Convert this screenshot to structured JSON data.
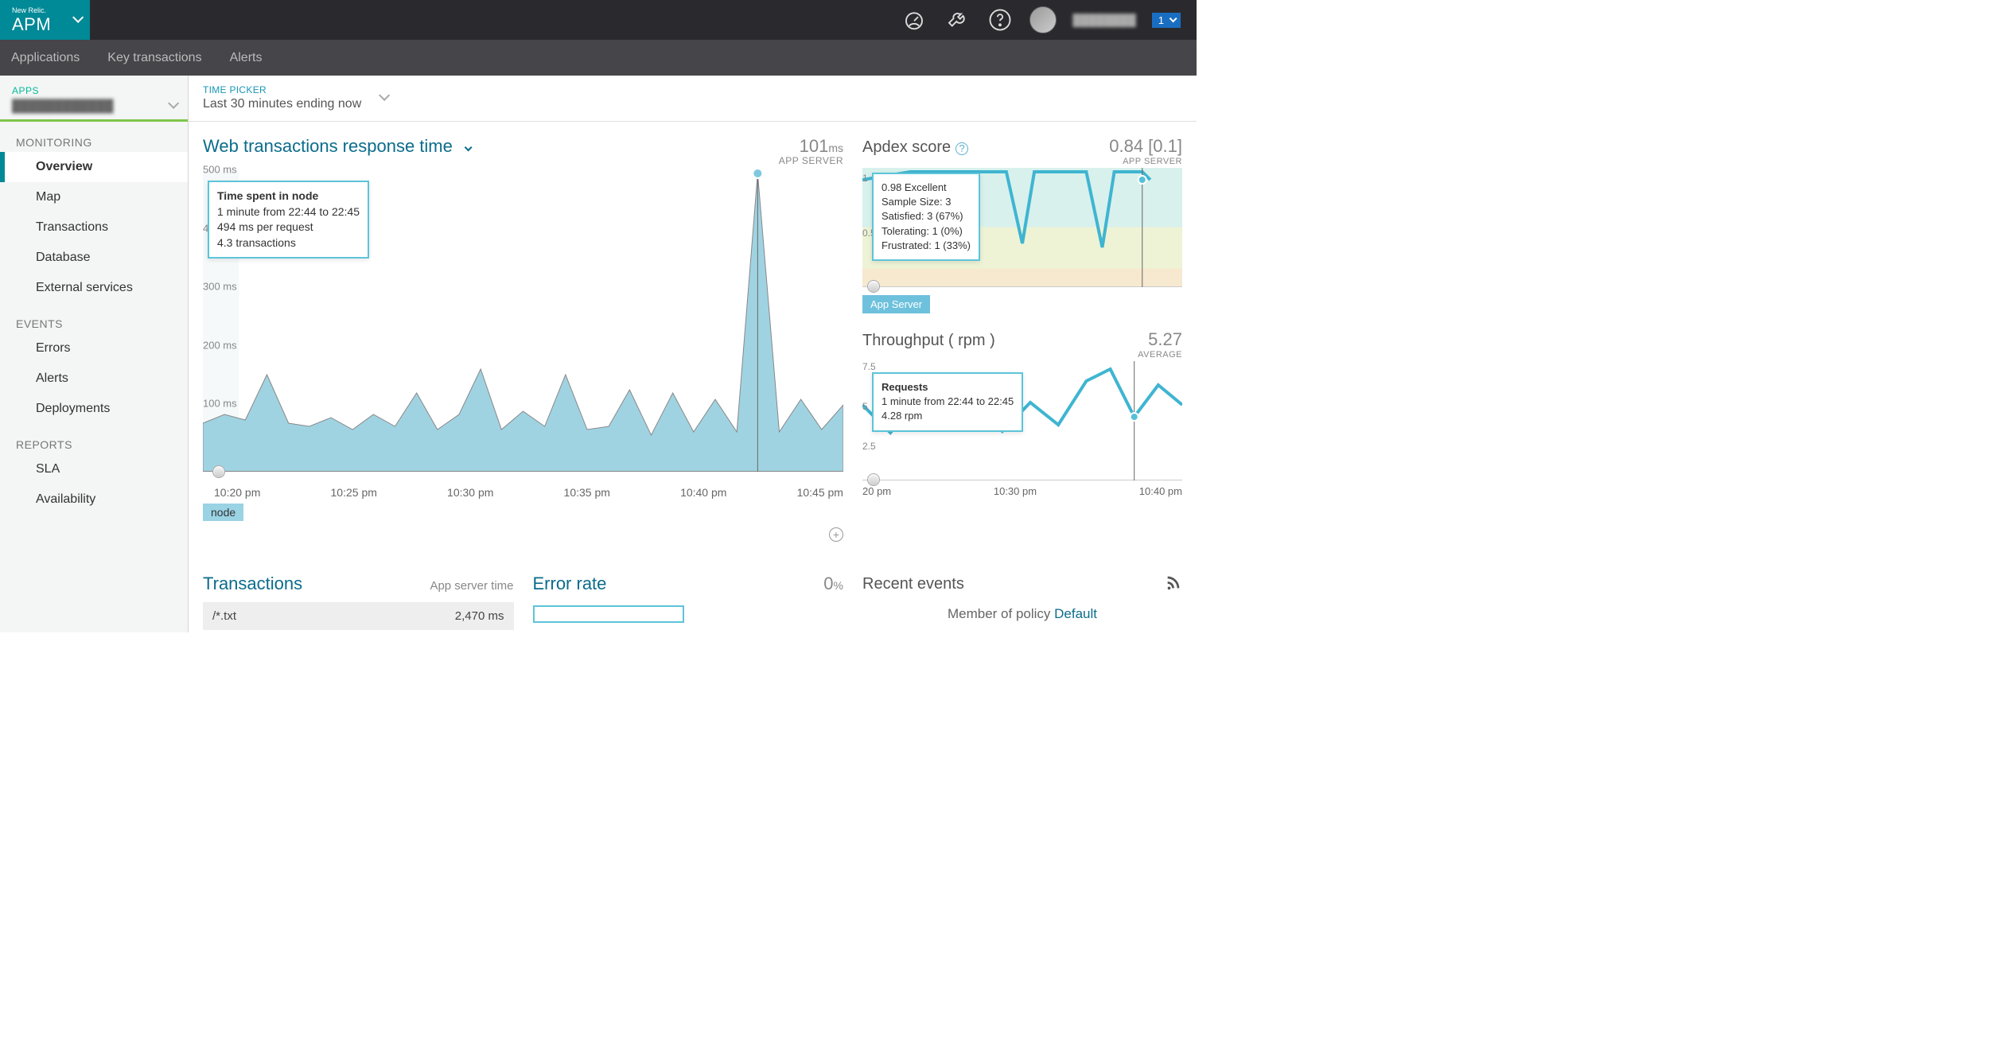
{
  "brand": {
    "vendor": "New Relic.",
    "product": "APM"
  },
  "topnav": {
    "apps": "Applications",
    "ktx": "Key transactions",
    "alerts": "Alerts"
  },
  "topright": {
    "notif_count": "1"
  },
  "apps_picker": {
    "label": "APPS"
  },
  "timepicker": {
    "label": "TIME PICKER",
    "value": "Last 30 minutes ending now"
  },
  "sidebar": {
    "sections": [
      {
        "label": "MONITORING",
        "items": [
          "Overview",
          "Map",
          "Transactions",
          "Database",
          "External services"
        ]
      },
      {
        "label": "EVENTS",
        "items": [
          "Errors",
          "Alerts",
          "Deployments"
        ]
      },
      {
        "label": "REPORTS",
        "items": [
          "SLA",
          "Availability"
        ]
      }
    ]
  },
  "web_chart": {
    "title": "Web transactions response time",
    "metric": "101",
    "metric_unit": "ms",
    "metric_sub": "APP SERVER",
    "tooltip": {
      "title": "Time spent in node",
      "l1": "1 minute from 22:44 to 22:45",
      "l2": "494 ms per request",
      "l3": "4.3 transactions"
    },
    "legend": "node",
    "y_ticks": [
      "500 ms",
      "400 ms",
      "300 ms",
      "200 ms",
      "100 ms",
      ""
    ],
    "x_ticks": [
      "10:20 pm",
      "10:25 pm",
      "10:30 pm",
      "10:35 pm",
      "10:40 pm",
      "10:45 pm"
    ]
  },
  "apdex": {
    "title": "Apdex score",
    "metric": "0.84 [0.1]",
    "sub": "APP SERVER",
    "tooltip": {
      "l1": "0.98 Excellent",
      "l2": "Sample Size: 3",
      "l3": "Satisfied: 3 (67%)",
      "l4": "Tolerating: 1 (0%)",
      "l5": "Frustrated: 1 (33%)"
    },
    "pill": "App Server",
    "y_ticks": [
      "1",
      "0.5"
    ]
  },
  "throughput": {
    "title": "Throughput ( rpm )",
    "metric": "5.27",
    "sub": "AVERAGE",
    "tooltip": {
      "l1": "Requests",
      "l2": "1 minute from 22:44 to 22:45",
      "l3": "4.28 rpm"
    },
    "y_ticks": [
      "7.5",
      "5",
      "2.5"
    ],
    "x_ticks": [
      "20 pm",
      "10:30 pm",
      "10:40 pm"
    ]
  },
  "transactions_panel": {
    "title": "Transactions",
    "col_label": "App server time",
    "row": {
      "name": "/*.txt",
      "value": "2,470 ms"
    }
  },
  "error_panel": {
    "title": "Error rate",
    "metric": "0",
    "unit": "%"
  },
  "events_panel": {
    "title": "Recent events",
    "policy_prefix": "Member of policy ",
    "policy_link": "Default"
  },
  "chart_data": [
    {
      "type": "area",
      "title": "Web transactions response time",
      "series": [
        {
          "name": "node",
          "x": [
            "22:17",
            "22:18",
            "22:19",
            "22:20",
            "22:21",
            "22:22",
            "22:23",
            "22:24",
            "22:25",
            "22:26",
            "22:27",
            "22:28",
            "22:29",
            "22:30",
            "22:31",
            "22:32",
            "22:33",
            "22:34",
            "22:35",
            "22:36",
            "22:37",
            "22:38",
            "22:39",
            "22:40",
            "22:41",
            "22:42",
            "22:43",
            "22:44",
            "22:45",
            "22:46",
            "22:47"
          ],
          "y": [
            80,
            95,
            85,
            160,
            80,
            75,
            90,
            70,
            95,
            75,
            130,
            70,
            95,
            170,
            70,
            100,
            75,
            160,
            70,
            75,
            135,
            60,
            130,
            65,
            120,
            65,
            494,
            65,
            120,
            70,
            110
          ]
        }
      ],
      "xlabel": "",
      "ylabel": "ms",
      "ylim": [
        0,
        500
      ]
    },
    {
      "type": "line",
      "title": "Apdex score",
      "series": [
        {
          "name": "App Server",
          "x": [
            "22:17",
            "22:20",
            "22:23",
            "22:26",
            "22:29",
            "22:32",
            "22:35",
            "22:38",
            "22:40",
            "22:42",
            "22:44",
            "22:46"
          ],
          "y": [
            0.95,
            1.0,
            1.0,
            1.0,
            1.0,
            1.0,
            0.6,
            1.0,
            1.0,
            0.55,
            1.0,
            0.98
          ]
        }
      ],
      "ylim": [
        0,
        1
      ]
    },
    {
      "type": "line",
      "title": "Throughput (rpm)",
      "series": [
        {
          "name": "Requests",
          "x": [
            "22:17",
            "22:20",
            "22:23",
            "22:26",
            "22:29",
            "22:32",
            "22:35",
            "22:38",
            "22:40",
            "22:42",
            "22:44",
            "22:46"
          ],
          "y": [
            5.0,
            3.5,
            5.5,
            3.8,
            5.8,
            3.6,
            5.2,
            4.0,
            6.5,
            7.3,
            4.28,
            6.0
          ]
        }
      ],
      "ylim": [
        0,
        7.5
      ]
    }
  ]
}
